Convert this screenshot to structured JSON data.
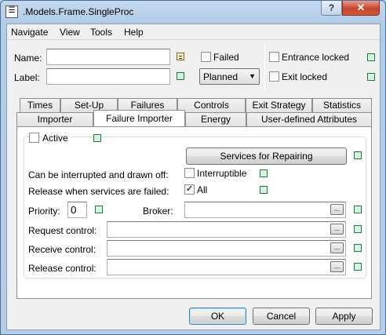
{
  "window": {
    "title": ".Models.Frame.SingleProc",
    "help_glyph": "?",
    "close_glyph": "✕",
    "icon_glyph": "☰"
  },
  "menu": [
    "Navigate",
    "View",
    "Tools",
    "Help"
  ],
  "header": {
    "name_label": "Name:",
    "name_value": "",
    "label_label": "Label:",
    "label_value": "",
    "failed_label": "Failed",
    "planned_value": "Planned",
    "entrance_locked_label": "Entrance locked",
    "exit_locked_label": "Exit locked"
  },
  "tabs_row1": [
    "Times",
    "Set-Up",
    "Failures",
    "Controls",
    "Exit Strategy",
    "Statistics"
  ],
  "tabs_row2": [
    "Importer",
    "Failure Importer",
    "Energy",
    "User-defined Attributes"
  ],
  "active_tab": "Failure Importer",
  "panel": {
    "active_label": "Active",
    "active_checked": false,
    "services_button": "Services for Repairing",
    "interrupted_label": "Can be interrupted and drawn off:",
    "interruptible_label": "Interruptible",
    "interruptible_checked": false,
    "release_failed_label": "Release when services are failed:",
    "all_label": "All",
    "all_checked": true,
    "priority_label": "Priority:",
    "priority_value": "0",
    "broker_label": "Broker:",
    "broker_value": "",
    "request_label": "Request control:",
    "request_value": "",
    "receive_label": "Receive control:",
    "receive_value": "",
    "release_label": "Release control:",
    "release_value": "",
    "browse_glyph": "..."
  },
  "buttons": {
    "ok": "OK",
    "cancel": "Cancel",
    "apply": "Apply"
  },
  "colors": {
    "indicator_green": "#d5f5e0",
    "indicator_yellow": "#f5eec3"
  }
}
